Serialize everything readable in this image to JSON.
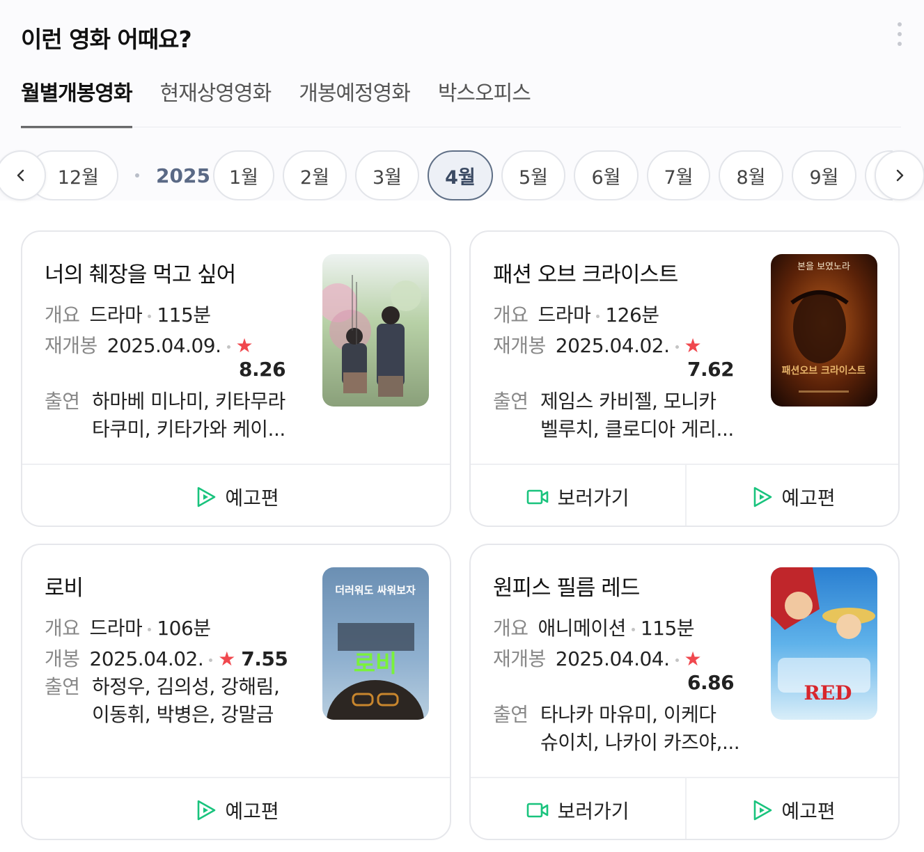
{
  "header": {
    "title": "이런 영화 어때요?"
  },
  "tabs": [
    {
      "label": "월별개봉영화",
      "active": true
    },
    {
      "label": "현재상영영화",
      "active": false
    },
    {
      "label": "개봉예정영화",
      "active": false
    },
    {
      "label": "박스오피스",
      "active": false
    }
  ],
  "months": {
    "prev_label": "12월",
    "year": "2025",
    "items": [
      "1월",
      "2월",
      "3월",
      "4월",
      "5월",
      "6월",
      "7월",
      "8월",
      "9월"
    ],
    "selected": "4월"
  },
  "cards": [
    {
      "title": "너의 췌장을 먹고 싶어",
      "genre_label": "개요",
      "genre": "드라마",
      "runtime": "115분",
      "date_label": "재개봉",
      "date": "2025.04.09.",
      "star": "★",
      "score": "8.26",
      "cast_label": "출연",
      "cast_line1": "하마베 미나미, 키타무라",
      "cast_line2": "타쿠미, 키타가와 케이...",
      "actions": [
        "예고편"
      ]
    },
    {
      "title": "패션 오브 크라이스트",
      "genre_label": "개요",
      "genre": "드라마",
      "runtime": "126분",
      "date_label": "재개봉",
      "date": "2025.04.02.",
      "star": "★",
      "score": "7.62",
      "cast_label": "출연",
      "cast_line1": "제임스 카비젤, 모니카",
      "cast_line2": "벨루치, 클로디아 게리...",
      "poster_text": "본을 보였노라",
      "poster_title": "패션오브 크라이스트",
      "actions": [
        "보러가기",
        "예고편"
      ]
    },
    {
      "title": "로비",
      "genre_label": "개요",
      "genre": "드라마",
      "runtime": "106분",
      "date_label": "개봉",
      "date": "2025.04.02.",
      "star": "★",
      "score": "7.55",
      "cast_label": "출연",
      "cast_line1": "하정우, 김의성, 강해림,",
      "cast_line2": "이동휘, 박병은, 강말금",
      "poster_text": "더러워도 싸워보자",
      "poster_title": "로비",
      "actions": [
        "예고편"
      ]
    },
    {
      "title": "원피스 필름 레드",
      "genre_label": "개요",
      "genre": "애니메이션",
      "runtime": "115분",
      "date_label": "재개봉",
      "date": "2025.04.04.",
      "star": "★",
      "score": "6.86",
      "cast_label": "출연",
      "cast_line1": "타나카 마유미, 이케다",
      "cast_line2": "슈이치, 나카이 카즈야,...",
      "poster_title": "RED",
      "actions": [
        "보러가기",
        "예고편"
      ]
    }
  ],
  "colors": {
    "star": "#f0484e",
    "play_icon": "#19c37d",
    "selected_month": "#5f6f86"
  }
}
